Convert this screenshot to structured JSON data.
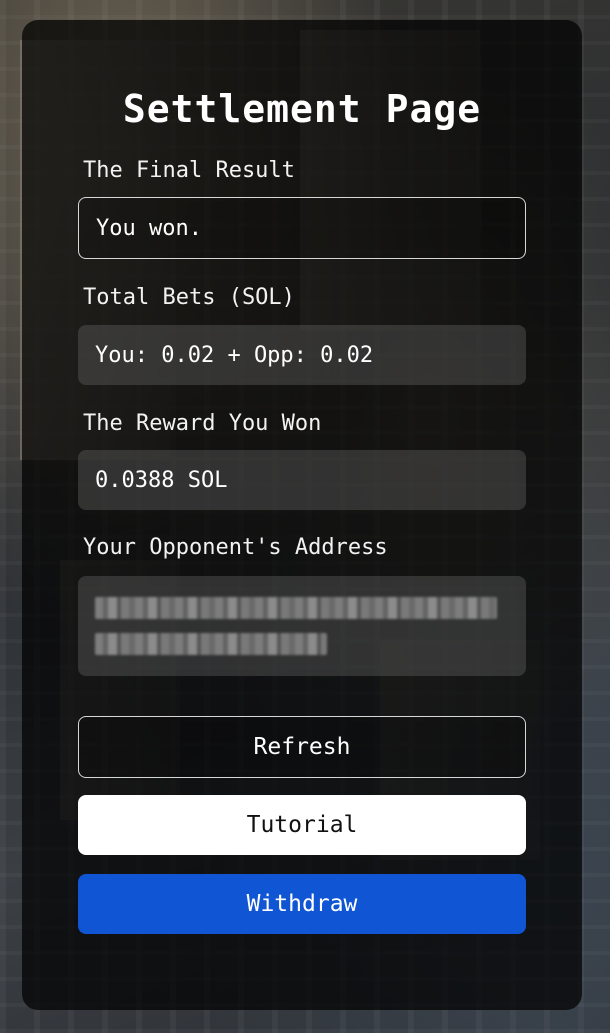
{
  "page": {
    "title": "Settlement Page"
  },
  "result": {
    "label": "The Final Result",
    "value": "You won."
  },
  "bets": {
    "label": "Total Bets (SOL)",
    "value": "You: 0.02 + Opp: 0.02"
  },
  "reward": {
    "label": "The Reward You Won",
    "value": "0.0388 SOL"
  },
  "opponent": {
    "label": "Your Opponent's Address",
    "value_visibility": "pixelated/redacted"
  },
  "buttons": {
    "refresh": "Refresh",
    "tutorial": "Tutorial",
    "withdraw": "Withdraw"
  },
  "colors": {
    "withdraw_button": "#0f55d4",
    "tutorial_button": "#ffffff",
    "card_background": "rgba(0,0,0,0.72)"
  }
}
